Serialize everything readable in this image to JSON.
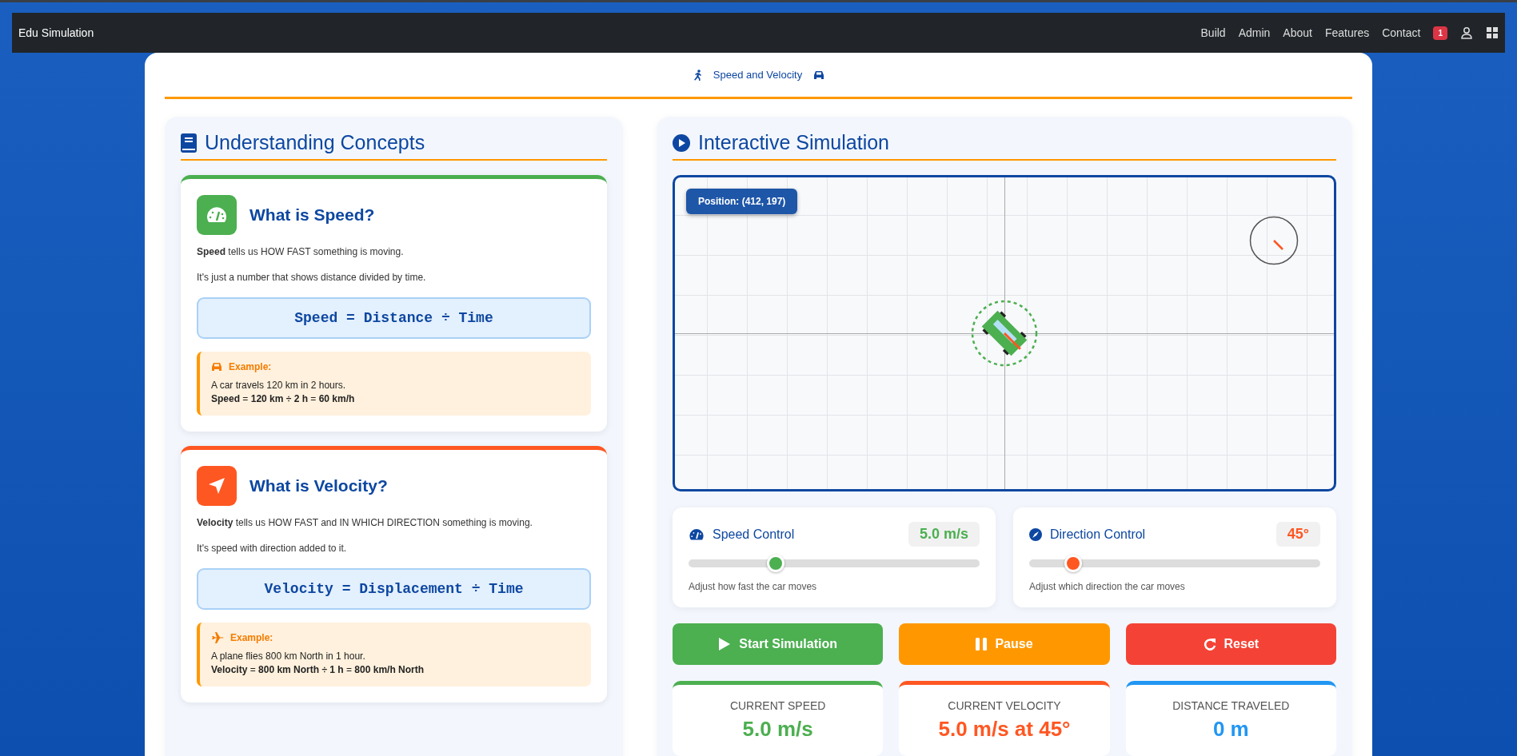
{
  "navbar": {
    "brand": "Edu Simulation",
    "links": [
      "Build",
      "Admin",
      "About",
      "Features",
      "Contact"
    ],
    "notification_count": "1"
  },
  "page_title": "Speed and Velocity",
  "concepts": {
    "title": "Understanding Concepts",
    "cards": [
      {
        "kind": "speed",
        "color": "#4caf50",
        "title": "What is Speed?",
        "description": "**Speed** tells us HOW FAST something is moving.",
        "note": "It's just a number that shows distance divided by time.",
        "formula": "Speed = Distance ÷ Time",
        "example_label": "Example:",
        "example_text": "A car travels 120 km in 2 hours.",
        "example_result": "**Speed** = **120 km ÷ 2 h** = **60 km/h**"
      },
      {
        "kind": "velocity",
        "color": "#ff5722",
        "title": "What is Velocity?",
        "description": "**Velocity** tells us HOW FAST and IN WHICH DIRECTION something is moving.",
        "note": "It's speed with direction added to it.",
        "formula": "Velocity = Displacement ÷ Time",
        "example_label": "Example:",
        "example_text": "A plane flies 800 km North in 1 hour.",
        "example_result": "**Velocity** = **800 km North ÷ 1 h** = **800 km/h North**"
      }
    ]
  },
  "simulation": {
    "title": "Interactive Simulation",
    "position_label": "Position: (412, 197)",
    "controls": [
      {
        "kind": "speed",
        "color": "#4caf50",
        "title": "Speed Control",
        "reading": "5.0 m/s",
        "level": 0.3,
        "hint": "Adjust how fast the car moves"
      },
      {
        "kind": "direction",
        "color": "#ff5722",
        "title": "Direction Control",
        "reading": "45°",
        "level": 0.15,
        "hint": "Adjust which direction the car moves"
      }
    ],
    "buttons": [
      {
        "kind": "start",
        "label": "Start Simulation"
      },
      {
        "kind": "pause",
        "label": "Pause"
      },
      {
        "kind": "reset",
        "label": "Reset"
      }
    ],
    "stats": [
      {
        "color": "#4caf50",
        "label": "CURRENT SPEED",
        "value": "5.0 m/s"
      },
      {
        "color": "#ff5722",
        "label": "CURRENT VELOCITY",
        "value": "5.0 m/s at 45°"
      },
      {
        "color": "#2196f3",
        "label": "DISTANCE TRAVELED",
        "value": "0 m"
      }
    ]
  }
}
